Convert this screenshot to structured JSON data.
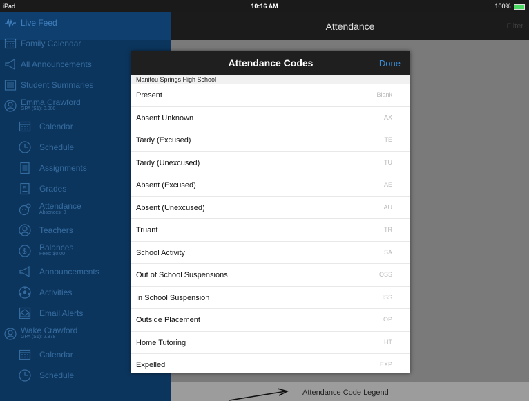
{
  "status_bar": {
    "device": "iPad",
    "time": "10:16 AM",
    "battery": "100%"
  },
  "sidebar": {
    "items": [
      {
        "label": "Live Feed",
        "icon": "activity-wave-icon",
        "level": 0
      },
      {
        "label": "Family Calendar",
        "icon": "calendar-icon",
        "level": 0
      },
      {
        "label": "All Announcements",
        "icon": "megaphone-icon",
        "level": 0
      },
      {
        "label": "Student Summaries",
        "icon": "list-icon",
        "level": 0
      },
      {
        "label": "Emma  Crawford",
        "sub": "GPA (S1): 0.000",
        "icon": "person-icon",
        "level": 0
      },
      {
        "label": "Calendar",
        "icon": "calendar-icon",
        "level": 1
      },
      {
        "label": "Schedule",
        "icon": "clock-icon",
        "level": 1
      },
      {
        "label": "Assignments",
        "icon": "document-icon",
        "level": 1
      },
      {
        "label": "Grades",
        "icon": "grades-icon",
        "level": 1
      },
      {
        "label": "Attendance",
        "sub": "Absences: 0",
        "icon": "attendance-icon",
        "level": 1
      },
      {
        "label": "Teachers",
        "icon": "person-icon",
        "level": 1
      },
      {
        "label": "Balances",
        "sub": "Fees: $0.00",
        "icon": "dollar-icon",
        "level": 1
      },
      {
        "label": "Announcements",
        "icon": "megaphone-icon",
        "level": 1
      },
      {
        "label": "Activities",
        "icon": "soccer-ball-icon",
        "level": 1
      },
      {
        "label": "Email Alerts",
        "icon": "envelope-icon",
        "level": 1
      },
      {
        "label": "Wake Crawford",
        "sub": "GPA (S1): 2.878",
        "icon": "person-icon",
        "level": 0
      },
      {
        "label": "Calendar",
        "icon": "calendar-icon",
        "level": 1
      },
      {
        "label": "Schedule",
        "icon": "clock-icon",
        "level": 1
      }
    ]
  },
  "header": {
    "title": "Attendance",
    "filter": "Filter"
  },
  "modal": {
    "title": "Attendance Codes",
    "done": "Done",
    "school": "Manitou Springs High School",
    "codes": [
      {
        "name": "Present",
        "code": "Blank"
      },
      {
        "name": "Absent Unknown",
        "code": "AX"
      },
      {
        "name": "Tardy (Excused)",
        "code": "TE"
      },
      {
        "name": "Tardy (Unexcused)",
        "code": "TU"
      },
      {
        "name": "Absent (Excused)",
        "code": "AE"
      },
      {
        "name": "Absent (Unexcused)",
        "code": "AU"
      },
      {
        "name": "Truant",
        "code": "TR"
      },
      {
        "name": "School Activity",
        "code": "SA"
      },
      {
        "name": "Out of School Suspensions",
        "code": "OSS"
      },
      {
        "name": "In School Suspension",
        "code": "ISS"
      },
      {
        "name": "Outside Placement",
        "code": "OP"
      },
      {
        "name": "Home Tutoring",
        "code": "HT"
      },
      {
        "name": "Expelled",
        "code": "EXP"
      }
    ]
  },
  "legend_link": "Attendance Code Legend",
  "colors": {
    "sidebar_bg": "#0f3f6e",
    "sidebar_text": "#3f7fbd",
    "accent": "#3a8cd6"
  }
}
